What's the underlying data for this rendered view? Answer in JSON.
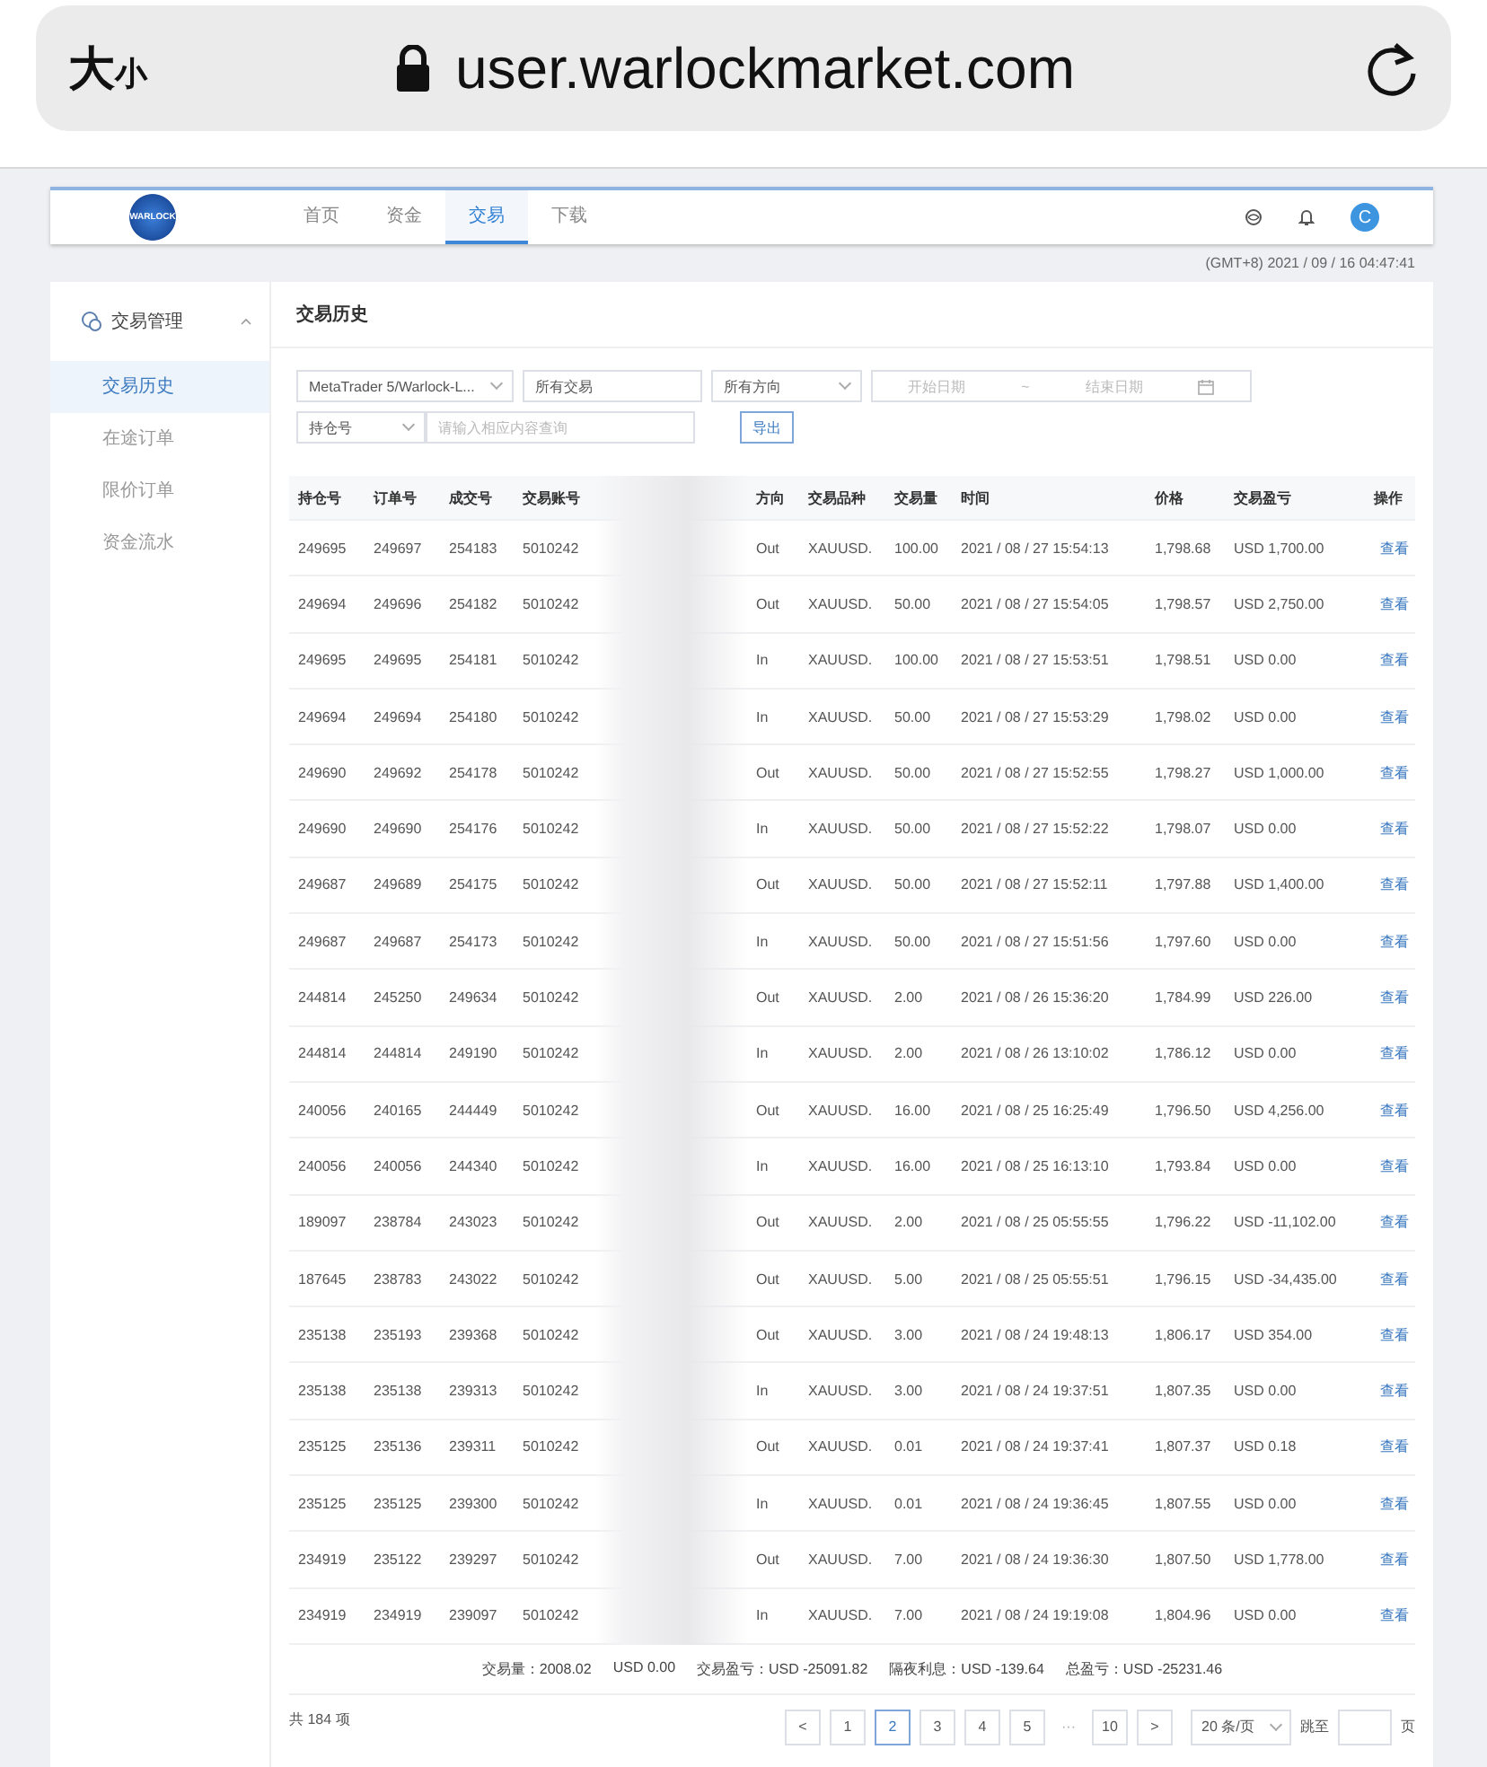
{
  "browser": {
    "text_size": "大",
    "text_size_small": "小",
    "url": "user.warlockmarket.com"
  },
  "nav": {
    "logo_text": "WARLOCK",
    "tabs": [
      {
        "label": "首页",
        "selected": false
      },
      {
        "label": "资金",
        "selected": false
      },
      {
        "label": "交易",
        "selected": true
      },
      {
        "label": "下载",
        "selected": false
      }
    ],
    "avatar": "C"
  },
  "clock": "(GMT+8) 2021 / 09 / 16 04:47:41",
  "sidebar": {
    "group": {
      "label": "交易管理",
      "expanded": true
    },
    "items": [
      {
        "label": "交易历史",
        "selected": true
      },
      {
        "label": "在途订单",
        "selected": false
      },
      {
        "label": "限价订单",
        "selected": false
      },
      {
        "label": "资金流水",
        "selected": false
      }
    ]
  },
  "page_title": "交易历史",
  "filters": {
    "account": "MetaTrader 5/Warlock-L...",
    "type": "所有交易",
    "direction": "所有方向",
    "start_placeholder": "开始日期",
    "range_sep": "~",
    "end_placeholder": "结束日期",
    "field": "持仓号",
    "search_placeholder": "请输入相应内容查询",
    "export": "导出"
  },
  "table": {
    "columns": [
      "持仓号",
      "订单号",
      "成交号",
      "交易账号",
      "方向",
      "交易品种",
      "交易量",
      "时间",
      "价格",
      "交易盈亏",
      "操作"
    ],
    "rows": [
      [
        "249695",
        "249697",
        "254183",
        "5010242",
        "Out",
        "XAUUSD.",
        "100.00",
        "2021 / 08 / 27 15:54:13",
        "1,798.68",
        "USD 1,700.00",
        "查看"
      ],
      [
        "249694",
        "249696",
        "254182",
        "5010242",
        "Out",
        "XAUUSD.",
        "50.00",
        "2021 / 08 / 27 15:54:05",
        "1,798.57",
        "USD 2,750.00",
        "查看"
      ],
      [
        "249695",
        "249695",
        "254181",
        "5010242",
        "In",
        "XAUUSD.",
        "100.00",
        "2021 / 08 / 27 15:53:51",
        "1,798.51",
        "USD 0.00",
        "查看"
      ],
      [
        "249694",
        "249694",
        "254180",
        "5010242",
        "In",
        "XAUUSD.",
        "50.00",
        "2021 / 08 / 27 15:53:29",
        "1,798.02",
        "USD 0.00",
        "查看"
      ],
      [
        "249690",
        "249692",
        "254178",
        "5010242",
        "Out",
        "XAUUSD.",
        "50.00",
        "2021 / 08 / 27 15:52:55",
        "1,798.27",
        "USD 1,000.00",
        "查看"
      ],
      [
        "249690",
        "249690",
        "254176",
        "5010242",
        "In",
        "XAUUSD.",
        "50.00",
        "2021 / 08 / 27 15:52:22",
        "1,798.07",
        "USD 0.00",
        "查看"
      ],
      [
        "249687",
        "249689",
        "254175",
        "5010242",
        "Out",
        "XAUUSD.",
        "50.00",
        "2021 / 08 / 27 15:52:11",
        "1,797.88",
        "USD 1,400.00",
        "查看"
      ],
      [
        "249687",
        "249687",
        "254173",
        "5010242",
        "In",
        "XAUUSD.",
        "50.00",
        "2021 / 08 / 27 15:51:56",
        "1,797.60",
        "USD 0.00",
        "查看"
      ],
      [
        "244814",
        "245250",
        "249634",
        "5010242",
        "Out",
        "XAUUSD.",
        "2.00",
        "2021 / 08 / 26 15:36:20",
        "1,784.99",
        "USD 226.00",
        "查看"
      ],
      [
        "244814",
        "244814",
        "249190",
        "5010242",
        "In",
        "XAUUSD.",
        "2.00",
        "2021 / 08 / 26 13:10:02",
        "1,786.12",
        "USD 0.00",
        "查看"
      ],
      [
        "240056",
        "240165",
        "244449",
        "5010242",
        "Out",
        "XAUUSD.",
        "16.00",
        "2021 / 08 / 25 16:25:49",
        "1,796.50",
        "USD 4,256.00",
        "查看"
      ],
      [
        "240056",
        "240056",
        "244340",
        "5010242",
        "In",
        "XAUUSD.",
        "16.00",
        "2021 / 08 / 25 16:13:10",
        "1,793.84",
        "USD 0.00",
        "查看"
      ],
      [
        "189097",
        "238784",
        "243023",
        "5010242",
        "Out",
        "XAUUSD.",
        "2.00",
        "2021 / 08 / 25 05:55:55",
        "1,796.22",
        "USD -11,102.00",
        "查看"
      ],
      [
        "187645",
        "238783",
        "243022",
        "5010242",
        "Out",
        "XAUUSD.",
        "5.00",
        "2021 / 08 / 25 05:55:51",
        "1,796.15",
        "USD -34,435.00",
        "查看"
      ],
      [
        "235138",
        "235193",
        "239368",
        "5010242",
        "Out",
        "XAUUSD.",
        "3.00",
        "2021 / 08 / 24 19:48:13",
        "1,806.17",
        "USD 354.00",
        "查看"
      ],
      [
        "235138",
        "235138",
        "239313",
        "5010242",
        "In",
        "XAUUSD.",
        "3.00",
        "2021 / 08 / 24 19:37:51",
        "1,807.35",
        "USD 0.00",
        "查看"
      ],
      [
        "235125",
        "235136",
        "239311",
        "5010242",
        "Out",
        "XAUUSD.",
        "0.01",
        "2021 / 08 / 24 19:37:41",
        "1,807.37",
        "USD 0.18",
        "查看"
      ],
      [
        "235125",
        "235125",
        "239300",
        "5010242",
        "In",
        "XAUUSD.",
        "0.01",
        "2021 / 08 / 24 19:36:45",
        "1,807.55",
        "USD 0.00",
        "查看"
      ],
      [
        "234919",
        "235122",
        "239297",
        "5010242",
        "Out",
        "XAUUSD.",
        "7.00",
        "2021 / 08 / 24 19:36:30",
        "1,807.50",
        "USD 1,778.00",
        "查看"
      ],
      [
        "234919",
        "234919",
        "239097",
        "5010242",
        "In",
        "XAUUSD.",
        "7.00",
        "2021 / 08 / 24 19:19:08",
        "1,804.96",
        "USD 0.00",
        "查看"
      ]
    ]
  },
  "summary": [
    "交易量：2008.02",
    "USD 0.00",
    "交易盈亏：USD -25091.82",
    "隔夜利息：USD -139.64",
    "总盈亏：USD -25231.46"
  ],
  "pagination": {
    "total": "共 184 项",
    "prev": "<",
    "pages": [
      {
        "label": "1",
        "selected": false
      },
      {
        "label": "2",
        "selected": true
      },
      {
        "label": "3",
        "selected": false
      },
      {
        "label": "4",
        "selected": false
      },
      {
        "label": "5",
        "selected": false
      }
    ],
    "ellipsis": "···",
    "last": "10",
    "next": ">",
    "page_size": "20 条/页",
    "jump_label": "跳至",
    "page_unit": "页"
  }
}
